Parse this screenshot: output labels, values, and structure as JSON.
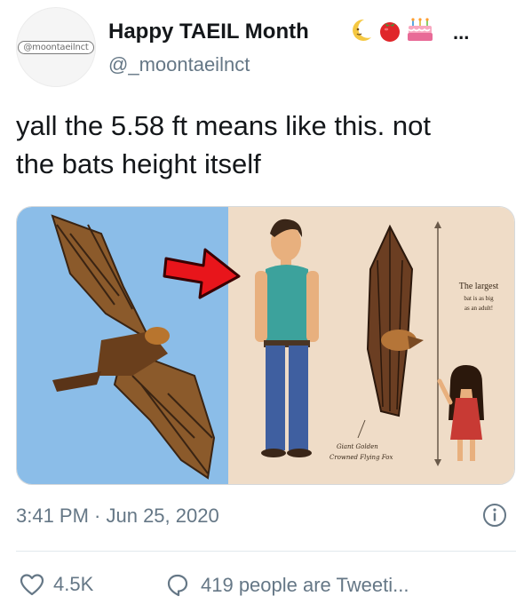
{
  "tweet": {
    "author": {
      "display_name": "Happy TAEIL Month",
      "name_emojis": [
        "crescent-moon",
        "tomato",
        "birthday-cake"
      ],
      "name_truncation": "...",
      "handle": "@_moontaeilnct",
      "avatar_text": "@moontaeilnct"
    },
    "text_line1": "yall the 5.58 ft means like this. not",
    "text_line2": "the bats height itself",
    "media": {
      "illustration_text_1": "The largest",
      "illustration_text_2": "bat is as big",
      "illustration_text_3": "as an adult!",
      "caption_1": "Giant Golden",
      "caption_2": "Crowned Flying Fox"
    },
    "timestamp": "3:41 PM · Jun 25, 2020",
    "likes_count": "4.5K",
    "replies_text": "419 people are Tweeti..."
  },
  "colors": {
    "text": "#14171a",
    "secondary": "#657786",
    "sky": "#8bbde8",
    "paper": "#efdcc7",
    "arrow": "#e8151b"
  },
  "icons": [
    "heart-icon",
    "reply-icon",
    "info-icon"
  ]
}
